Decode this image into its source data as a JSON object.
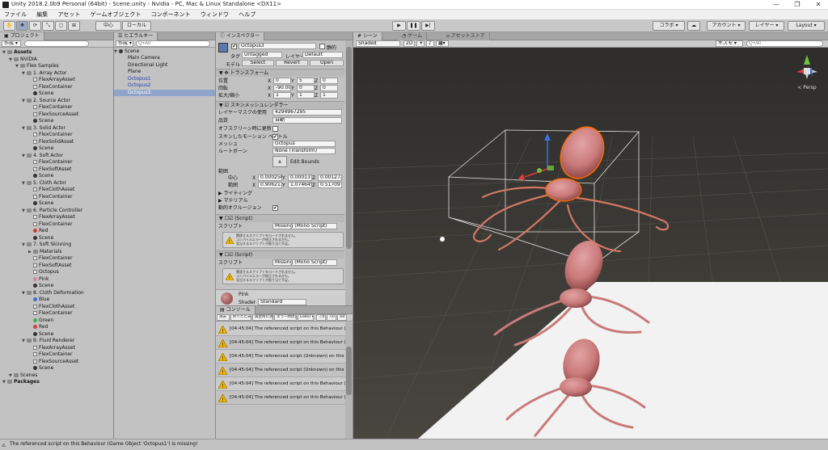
{
  "window": {
    "title": "Unity 2018.2.0b9 Personal (64bit) - Scene.unity - Nvidia - PC, Mac & Linux Standalone <DX11>",
    "minimize": "—",
    "maximize": "❐",
    "close": "✕"
  },
  "menu": [
    "ファイル",
    "編集",
    "アセット",
    "ゲームオブジェクト",
    "コンポーネント",
    "ウィンドウ",
    "ヘルプ"
  ],
  "toolbar": {
    "pivot": "中心",
    "local": "ローカル",
    "collab": "コラボ ▾",
    "account": "アカウント ▾",
    "layers": "レイヤー ▾",
    "layout": "Layout ▾"
  },
  "project": {
    "tab": "プロジェクト",
    "create": "作成 ▾",
    "tree": [
      {
        "label": "Assets",
        "depth": 0,
        "icon": "folder",
        "bold": true
      },
      {
        "label": "NVIDIA",
        "depth": 1,
        "icon": "folder"
      },
      {
        "label": "Flex Samples",
        "depth": 2,
        "icon": "folder"
      },
      {
        "label": "1. Array Actor",
        "depth": 3,
        "icon": "folder"
      },
      {
        "label": "FlexArrayAsset",
        "depth": 4,
        "icon": "asset"
      },
      {
        "label": "FlexContainer",
        "depth": 4,
        "icon": "asset"
      },
      {
        "label": "Scene",
        "depth": 4,
        "icon": "unity"
      },
      {
        "label": "2. Source Actor",
        "depth": 3,
        "icon": "folder"
      },
      {
        "label": "FlexContainer",
        "depth": 4,
        "icon": "asset"
      },
      {
        "label": "FlexSourceAsset",
        "depth": 4,
        "icon": "asset"
      },
      {
        "label": "Scene",
        "depth": 4,
        "icon": "unity"
      },
      {
        "label": "3. Solid Actor",
        "depth": 3,
        "icon": "folder"
      },
      {
        "label": "FlexContainer",
        "depth": 4,
        "icon": "asset"
      },
      {
        "label": "FlexSolidAsset",
        "depth": 4,
        "icon": "asset"
      },
      {
        "label": "Scene",
        "depth": 4,
        "icon": "unity"
      },
      {
        "label": "4. Soft Actor",
        "depth": 3,
        "icon": "folder"
      },
      {
        "label": "FlexContainer",
        "depth": 4,
        "icon": "asset"
      },
      {
        "label": "FlexSoftAsset",
        "depth": 4,
        "icon": "asset"
      },
      {
        "label": "Scene",
        "depth": 4,
        "icon": "unity"
      },
      {
        "label": "5. Cloth Actor",
        "depth": 3,
        "icon": "folder"
      },
      {
        "label": "FlexClothAsset",
        "depth": 4,
        "icon": "asset"
      },
      {
        "label": "FlexContainer",
        "depth": 4,
        "icon": "asset"
      },
      {
        "label": "Scene",
        "depth": 4,
        "icon": "unity"
      },
      {
        "label": "6. Particle Controller",
        "depth": 3,
        "icon": "folder"
      },
      {
        "label": "FlexArrayAsset",
        "depth": 4,
        "icon": "asset"
      },
      {
        "label": "FlexContainer",
        "depth": 4,
        "icon": "asset"
      },
      {
        "label": "Red",
        "depth": 4,
        "icon": "mat-red"
      },
      {
        "label": "Scene",
        "depth": 4,
        "icon": "unity"
      },
      {
        "label": "7. Soft Skinning",
        "depth": 3,
        "icon": "folder"
      },
      {
        "label": "Materials",
        "depth": 4,
        "icon": "folder"
      },
      {
        "label": "FlexContainer",
        "depth": 4,
        "icon": "asset"
      },
      {
        "label": "FlexSoftAsset",
        "depth": 4,
        "icon": "asset"
      },
      {
        "label": "Octopus",
        "depth": 4,
        "icon": "asset"
      },
      {
        "label": "Pink",
        "depth": 4,
        "icon": "mat-pink"
      },
      {
        "label": "Scene",
        "depth": 4,
        "icon": "unity"
      },
      {
        "label": "8. Cloth Deformation",
        "depth": 3,
        "icon": "folder"
      },
      {
        "label": "Blue",
        "depth": 4,
        "icon": "mat-blue"
      },
      {
        "label": "FlexClothAsset",
        "depth": 4,
        "icon": "asset"
      },
      {
        "label": "FlexContainer",
        "depth": 4,
        "icon": "asset"
      },
      {
        "label": "Green",
        "depth": 4,
        "icon": "mat-green"
      },
      {
        "label": "Red",
        "depth": 4,
        "icon": "mat-red"
      },
      {
        "label": "Scene",
        "depth": 4,
        "icon": "unity"
      },
      {
        "label": "9. Fluid Renderer",
        "depth": 3,
        "icon": "folder"
      },
      {
        "label": "FlexArrayAsset",
        "depth": 4,
        "icon": "asset"
      },
      {
        "label": "FlexContainer",
        "depth": 4,
        "icon": "asset"
      },
      {
        "label": "FlexSourceAsset",
        "depth": 4,
        "icon": "asset"
      },
      {
        "label": "Scene",
        "depth": 4,
        "icon": "unity"
      },
      {
        "label": "Scenes",
        "depth": 1,
        "icon": "folder"
      },
      {
        "label": "Packages",
        "depth": 0,
        "icon": "folder",
        "bold": true
      }
    ]
  },
  "hierarchy": {
    "tab": "ヒエラルキー",
    "create": "作成 ▾",
    "search_placeholder": "Q+All",
    "scene": "Scene",
    "items": [
      {
        "label": "Main Camera",
        "selected": false
      },
      {
        "label": "Directional Light",
        "selected": false
      },
      {
        "label": "Plane",
        "selected": false
      },
      {
        "label": "Octopus1",
        "selected": false,
        "blue": true
      },
      {
        "label": "Octopus2",
        "selected": false,
        "blue": true
      },
      {
        "label": "Octopus3",
        "selected": true,
        "blue": true
      }
    ]
  },
  "inspector": {
    "tab": "インスペクター",
    "object_name": "Octopus3",
    "static_label": "静的",
    "tag_label": "タグ",
    "tag_value": "Untagged",
    "layer_label": "レイヤー",
    "layer_value": "Default",
    "model_label": "モデル",
    "select": "Select",
    "revert": "Revert",
    "open": "Open",
    "transform_title": "トランスフォーム",
    "position_label": "位置",
    "rotation_label": "回転",
    "scale_label": "拡大/縮小",
    "position": [
      "0",
      "5",
      "0"
    ],
    "rotation": [
      "-90.0000",
      "0",
      "0"
    ],
    "scale": [
      "1",
      "1",
      "1"
    ],
    "smr_title": "スキンメッシュレンダラー",
    "layer_mask_label": "レイヤーマスクの使用",
    "layer_mask_value": "4294967295",
    "quality_label": "品質",
    "quality_value": "自動",
    "offscreen_label": "オフスクリーン時に更新",
    "skinned_motion_label": "スキンしたモーション ベクトル",
    "mesh_label": "メッシュ",
    "mesh_value": "Octopus",
    "rootbone_label": "ルートボーン",
    "rootbone_value": "None (Transform)",
    "edit_bounds": "Edit Bounds",
    "bounds_label": "範囲",
    "center_label": "中心",
    "extent_label": "範囲",
    "center": [
      "0.0002565",
      "0.0001379",
      "0.0012724"
    ],
    "extent": [
      "0.9062115",
      "1.074645",
      "0.5170972"
    ],
    "lighting": "ライティング",
    "materials": "マテリアル",
    "dynamic_occluded": "動的オクルージョン",
    "script_title": "(Script)",
    "script_label": "スクリプト",
    "script_value": "Missing (Mono Script)",
    "warning_text": "関連するスクリプトをロードされません。\nコンパイルエラーが修正されるかも。\n見当するスクリプトが割り当て不足。",
    "material_name": "Pink",
    "shader_label": "Shader",
    "shader_value": "Standard"
  },
  "console": {
    "tab": "コンソール",
    "buttons": [
      "消去",
      "折りたたみ",
      "再生時に消去",
      "エラー時停止",
      "Editor ▾"
    ],
    "counts": [
      "0",
      "0",
      "0"
    ],
    "messages": [
      "[04:45:04] The referenced script on this Behaviour (Game",
      "[04:45:04] The referenced script on this Behaviour (Game",
      "[04:45:04] The referenced script (Unknown) on this Behav",
      "[04:45:04] The referenced script (Unknown) on this Behav",
      "[04:45:04] The referenced script on this Behaviour (Game",
      "[04:45:04] The referenced script on this Behaviour (Game"
    ]
  },
  "scene_view": {
    "tabs": [
      "シーン",
      "ゲーム",
      "アセットストア"
    ],
    "shading": "Shaded",
    "mode_2d": "2D",
    "gizmos": "ギズモ ▾",
    "search_placeholder": "Q+All",
    "persp": "< Persp"
  },
  "status": {
    "message": "The referenced script on this Behaviour (Game Object 'Octopus1') is missing!"
  },
  "colors": {
    "selection": "#8fa4c8",
    "octopus": "#c97a7a",
    "outline": "#ff6a00",
    "warning": "#f2b600"
  }
}
